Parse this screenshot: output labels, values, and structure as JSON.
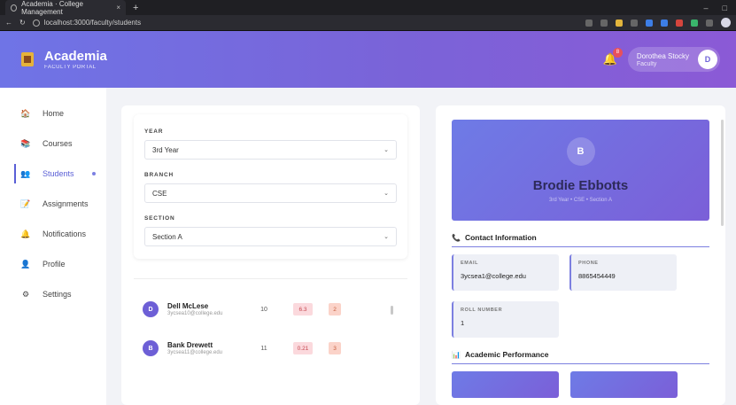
{
  "browser": {
    "tab_title": "Academia · College Management",
    "url": "localhost:3000/faculty/students",
    "new_tab": "+",
    "close": "×"
  },
  "header": {
    "brand_title": "Academia",
    "brand_subtitle": "FACULTY PORTAL",
    "notification_count": "8",
    "user_name": "Dorothea Stocky",
    "user_role": "Faculty",
    "user_initial": "D"
  },
  "sidebar": {
    "items": [
      {
        "label": "Home",
        "icon": "home-icon"
      },
      {
        "label": "Courses",
        "icon": "books-icon"
      },
      {
        "label": "Students",
        "icon": "students-icon"
      },
      {
        "label": "Assignments",
        "icon": "assignment-icon"
      },
      {
        "label": "Notifications",
        "icon": "bell-icon"
      },
      {
        "label": "Profile",
        "icon": "user-icon"
      },
      {
        "label": "Settings",
        "icon": "gear-icon"
      }
    ]
  },
  "filters": {
    "year_label": "YEAR",
    "year_value": "3rd Year",
    "branch_label": "BRANCH",
    "branch_value": "CSE",
    "section_label": "SECTION",
    "section_value": "Section A"
  },
  "students": [
    {
      "initial": "D",
      "name": "Dell McLese",
      "email": "3ycsea10@college.edu",
      "roll": "10",
      "gpa": "6.3",
      "badge": "2"
    },
    {
      "initial": "B",
      "name": "Bank Drewett",
      "email": "3ycsea11@college.edu",
      "roll": "11",
      "gpa": "0.21",
      "badge": "3"
    }
  ],
  "profile": {
    "initial": "B",
    "name": "Brodie Ebbotts",
    "subtitle": "3rd Year • CSE • Section A",
    "contact_title": "Contact Information",
    "email_label": "EMAIL",
    "email_value": "3ycsea1@college.edu",
    "phone_label": "PHONE",
    "phone_value": "8865454449",
    "roll_label": "ROLL NUMBER",
    "roll_value": "1",
    "performance_title": "Academic Performance"
  }
}
